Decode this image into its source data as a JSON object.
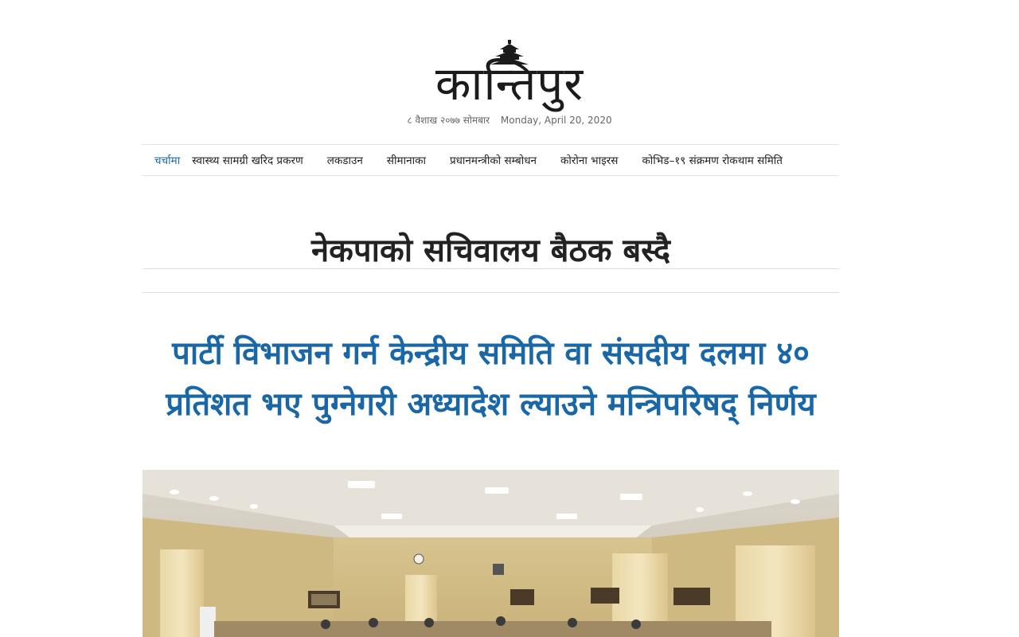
{
  "masthead": {
    "logo_text": "कान्तिपुर",
    "date_nepali": "८ वैशाख २०७७ सोमबार",
    "date_english": "Monday, April 20, 2020"
  },
  "nav": {
    "label": "चर्चामा",
    "items": [
      "स्वास्थ्य सामग्री खरिद प्रकरण",
      "लकडाउन",
      "सीमानाका",
      "प्रधानमन्त्रीको सम्बोधन",
      "कोरोना भाइरस",
      "कोभिड–१९ संक्रमण रोकथाम समिति"
    ]
  },
  "topic_heading": "नेकपाको सचिवालय बैठक बस्दै",
  "headline": "पार्टी विभाजन गर्न केन्द्रीय समिति वा संसदीय दलमा ४० प्रतिशत भए पुग्नेगरी अध्यादेश ल्याउने मन्त्रिपरिषद् निर्णय",
  "colors": {
    "accent": "#1a67a8",
    "text": "#222222"
  }
}
